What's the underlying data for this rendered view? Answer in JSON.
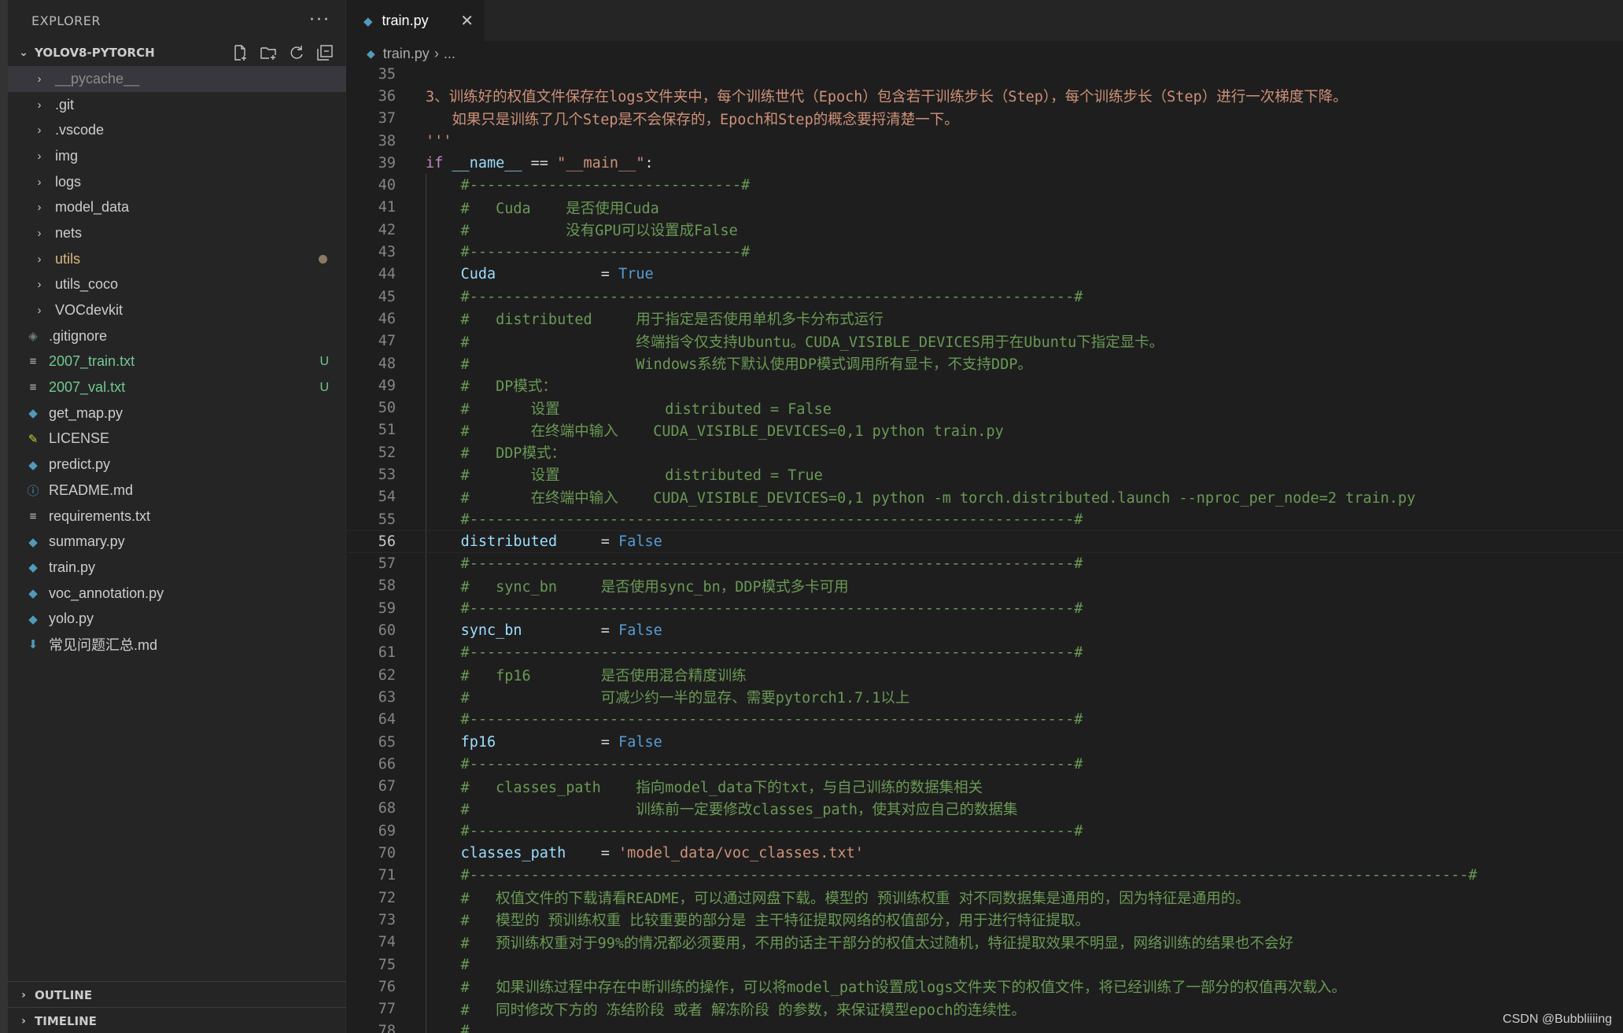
{
  "sidebar": {
    "title": "EXPLORER",
    "more_label": "···",
    "project_name": "YOLOV8-PYTORCH",
    "outline_label": "OUTLINE",
    "timeline_label": "TIMELINE"
  },
  "explorer": {
    "items": [
      {
        "name": "__pycache__",
        "type": "folder",
        "status": "dim"
      },
      {
        "name": ".git",
        "type": "folder"
      },
      {
        "name": ".vscode",
        "type": "folder"
      },
      {
        "name": "img",
        "type": "folder"
      },
      {
        "name": "logs",
        "type": "folder"
      },
      {
        "name": "model_data",
        "type": "folder"
      },
      {
        "name": "nets",
        "type": "folder"
      },
      {
        "name": "utils",
        "type": "folder",
        "status": "modified"
      },
      {
        "name": "utils_coco",
        "type": "folder"
      },
      {
        "name": "VOCdevkit",
        "type": "folder"
      },
      {
        "name": ".gitignore",
        "type": "git"
      },
      {
        "name": "2007_train.txt",
        "type": "txt",
        "status": "untracked",
        "badge": "U"
      },
      {
        "name": "2007_val.txt",
        "type": "txt",
        "status": "untracked",
        "badge": "U"
      },
      {
        "name": "get_map.py",
        "type": "py"
      },
      {
        "name": "LICENSE",
        "type": "license"
      },
      {
        "name": "predict.py",
        "type": "py"
      },
      {
        "name": "README.md",
        "type": "info"
      },
      {
        "name": "requirements.txt",
        "type": "txt"
      },
      {
        "name": "summary.py",
        "type": "py"
      },
      {
        "name": "train.py",
        "type": "py"
      },
      {
        "name": "voc_annotation.py",
        "type": "py"
      },
      {
        "name": "yolo.py",
        "type": "py"
      },
      {
        "name": "常见问题汇总.md",
        "type": "md"
      }
    ]
  },
  "editor": {
    "tab_label": "train.py",
    "close_glyph": "✕",
    "breadcrumb_file": "train.py",
    "breadcrumb_more": "...",
    "current_line": 56,
    "lines": [
      {
        "n": 35,
        "tokens": []
      },
      {
        "n": 36,
        "tokens": [
          [
            "string",
            "3、训练好的权值文件保存在logs文件夹中，每个训练世代（Epoch）包含若干训练步长（Step），每个训练步长（Step）进行一次梯度下降。"
          ]
        ]
      },
      {
        "n": 37,
        "tokens": [
          [
            "string",
            "   如果只是训练了几个Step是不会保存的，Epoch和Step的概念要捋清楚一下。"
          ]
        ]
      },
      {
        "n": 38,
        "tokens": [
          [
            "string",
            "'''"
          ]
        ]
      },
      {
        "n": 39,
        "tokens": [
          [
            "keyword",
            "if"
          ],
          [
            "op",
            " "
          ],
          [
            "var",
            "__name__"
          ],
          [
            "op",
            " == "
          ],
          [
            "string",
            "\"__main__\""
          ],
          [
            "op",
            ":"
          ]
        ]
      },
      {
        "n": 40,
        "tokens": [
          [
            "comment",
            "    #-------------------------------#"
          ]
        ]
      },
      {
        "n": 41,
        "tokens": [
          [
            "comment",
            "    #   Cuda    是否使用Cuda"
          ]
        ]
      },
      {
        "n": 42,
        "tokens": [
          [
            "comment",
            "    #           没有GPU可以设置成False"
          ]
        ]
      },
      {
        "n": 43,
        "tokens": [
          [
            "comment",
            "    #-------------------------------#"
          ]
        ]
      },
      {
        "n": 44,
        "tokens": [
          [
            "op",
            "    "
          ],
          [
            "var",
            "Cuda"
          ],
          [
            "op",
            "            = "
          ],
          [
            "const",
            "True"
          ]
        ]
      },
      {
        "n": 45,
        "tokens": [
          [
            "comment",
            "    #---------------------------------------------------------------------#"
          ]
        ]
      },
      {
        "n": 46,
        "tokens": [
          [
            "comment",
            "    #   distributed     用于指定是否使用单机多卡分布式运行"
          ]
        ]
      },
      {
        "n": 47,
        "tokens": [
          [
            "comment",
            "    #                   终端指令仅支持Ubuntu。CUDA_VISIBLE_DEVICES用于在Ubuntu下指定显卡。"
          ]
        ]
      },
      {
        "n": 48,
        "tokens": [
          [
            "comment",
            "    #                   Windows系统下默认使用DP模式调用所有显卡，不支持DDP。"
          ]
        ]
      },
      {
        "n": 49,
        "tokens": [
          [
            "comment",
            "    #   DP模式："
          ]
        ]
      },
      {
        "n": 50,
        "tokens": [
          [
            "comment",
            "    #       设置            distributed = False"
          ]
        ]
      },
      {
        "n": 51,
        "tokens": [
          [
            "comment",
            "    #       在终端中输入    CUDA_VISIBLE_DEVICES=0,1 python train.py"
          ]
        ]
      },
      {
        "n": 52,
        "tokens": [
          [
            "comment",
            "    #   DDP模式："
          ]
        ]
      },
      {
        "n": 53,
        "tokens": [
          [
            "comment",
            "    #       设置            distributed = True"
          ]
        ]
      },
      {
        "n": 54,
        "tokens": [
          [
            "comment",
            "    #       在终端中输入    CUDA_VISIBLE_DEVICES=0,1 python -m torch.distributed.launch --nproc_per_node=2 train.py"
          ]
        ]
      },
      {
        "n": 55,
        "tokens": [
          [
            "comment",
            "    #---------------------------------------------------------------------#"
          ]
        ]
      },
      {
        "n": 56,
        "tokens": [
          [
            "op",
            "    "
          ],
          [
            "var",
            "distributed"
          ],
          [
            "op",
            "     = "
          ],
          [
            "const",
            "False"
          ]
        ]
      },
      {
        "n": 57,
        "tokens": [
          [
            "comment",
            "    #---------------------------------------------------------------------#"
          ]
        ]
      },
      {
        "n": 58,
        "tokens": [
          [
            "comment",
            "    #   sync_bn     是否使用sync_bn，DDP模式多卡可用"
          ]
        ]
      },
      {
        "n": 59,
        "tokens": [
          [
            "comment",
            "    #---------------------------------------------------------------------#"
          ]
        ]
      },
      {
        "n": 60,
        "tokens": [
          [
            "op",
            "    "
          ],
          [
            "var",
            "sync_bn"
          ],
          [
            "op",
            "         = "
          ],
          [
            "const",
            "False"
          ]
        ]
      },
      {
        "n": 61,
        "tokens": [
          [
            "comment",
            "    #---------------------------------------------------------------------#"
          ]
        ]
      },
      {
        "n": 62,
        "tokens": [
          [
            "comment",
            "    #   fp16        是否使用混合精度训练"
          ]
        ]
      },
      {
        "n": 63,
        "tokens": [
          [
            "comment",
            "    #               可减少约一半的显存、需要pytorch1.7.1以上"
          ]
        ]
      },
      {
        "n": 64,
        "tokens": [
          [
            "comment",
            "    #---------------------------------------------------------------------#"
          ]
        ]
      },
      {
        "n": 65,
        "tokens": [
          [
            "op",
            "    "
          ],
          [
            "var",
            "fp16"
          ],
          [
            "op",
            "            = "
          ],
          [
            "const",
            "False"
          ]
        ]
      },
      {
        "n": 66,
        "tokens": [
          [
            "comment",
            "    #---------------------------------------------------------------------#"
          ]
        ]
      },
      {
        "n": 67,
        "tokens": [
          [
            "comment",
            "    #   classes_path    指向model_data下的txt，与自己训练的数据集相关"
          ]
        ]
      },
      {
        "n": 68,
        "tokens": [
          [
            "comment",
            "    #                   训练前一定要修改classes_path，使其对应自己的数据集"
          ]
        ]
      },
      {
        "n": 69,
        "tokens": [
          [
            "comment",
            "    #---------------------------------------------------------------------#"
          ]
        ]
      },
      {
        "n": 70,
        "tokens": [
          [
            "op",
            "    "
          ],
          [
            "var",
            "classes_path"
          ],
          [
            "op",
            "    = "
          ],
          [
            "string",
            "'model_data/voc_classes.txt'"
          ]
        ]
      },
      {
        "n": 71,
        "tokens": [
          [
            "comment",
            "    #------------------------------------------------------------------------------------------------------------------#"
          ]
        ]
      },
      {
        "n": 72,
        "tokens": [
          [
            "comment",
            "    #   权值文件的下载请看README，可以通过网盘下载。模型的 预训练权重 对不同数据集是通用的，因为特征是通用的。"
          ]
        ]
      },
      {
        "n": 73,
        "tokens": [
          [
            "comment",
            "    #   模型的 预训练权重 比较重要的部分是 主干特征提取网络的权值部分，用于进行特征提取。"
          ]
        ]
      },
      {
        "n": 74,
        "tokens": [
          [
            "comment",
            "    #   预训练权重对于99%的情况都必须要用，不用的话主干部分的权值太过随机，特征提取效果不明显，网络训练的结果也不会好"
          ]
        ]
      },
      {
        "n": 75,
        "tokens": [
          [
            "comment",
            "    #"
          ]
        ]
      },
      {
        "n": 76,
        "tokens": [
          [
            "comment",
            "    #   如果训练过程中存在中断训练的操作，可以将model_path设置成logs文件夹下的权值文件，将已经训练了一部分的权值再次载入。"
          ]
        ]
      },
      {
        "n": 77,
        "tokens": [
          [
            "comment",
            "    #   同时修改下方的 冻结阶段 或者 解冻阶段 的参数，来保证模型epoch的连续性。"
          ]
        ]
      },
      {
        "n": 78,
        "tokens": [
          [
            "comment",
            "    #"
          ]
        ]
      }
    ]
  },
  "watermark": "CSDN @Bubbliiiing"
}
